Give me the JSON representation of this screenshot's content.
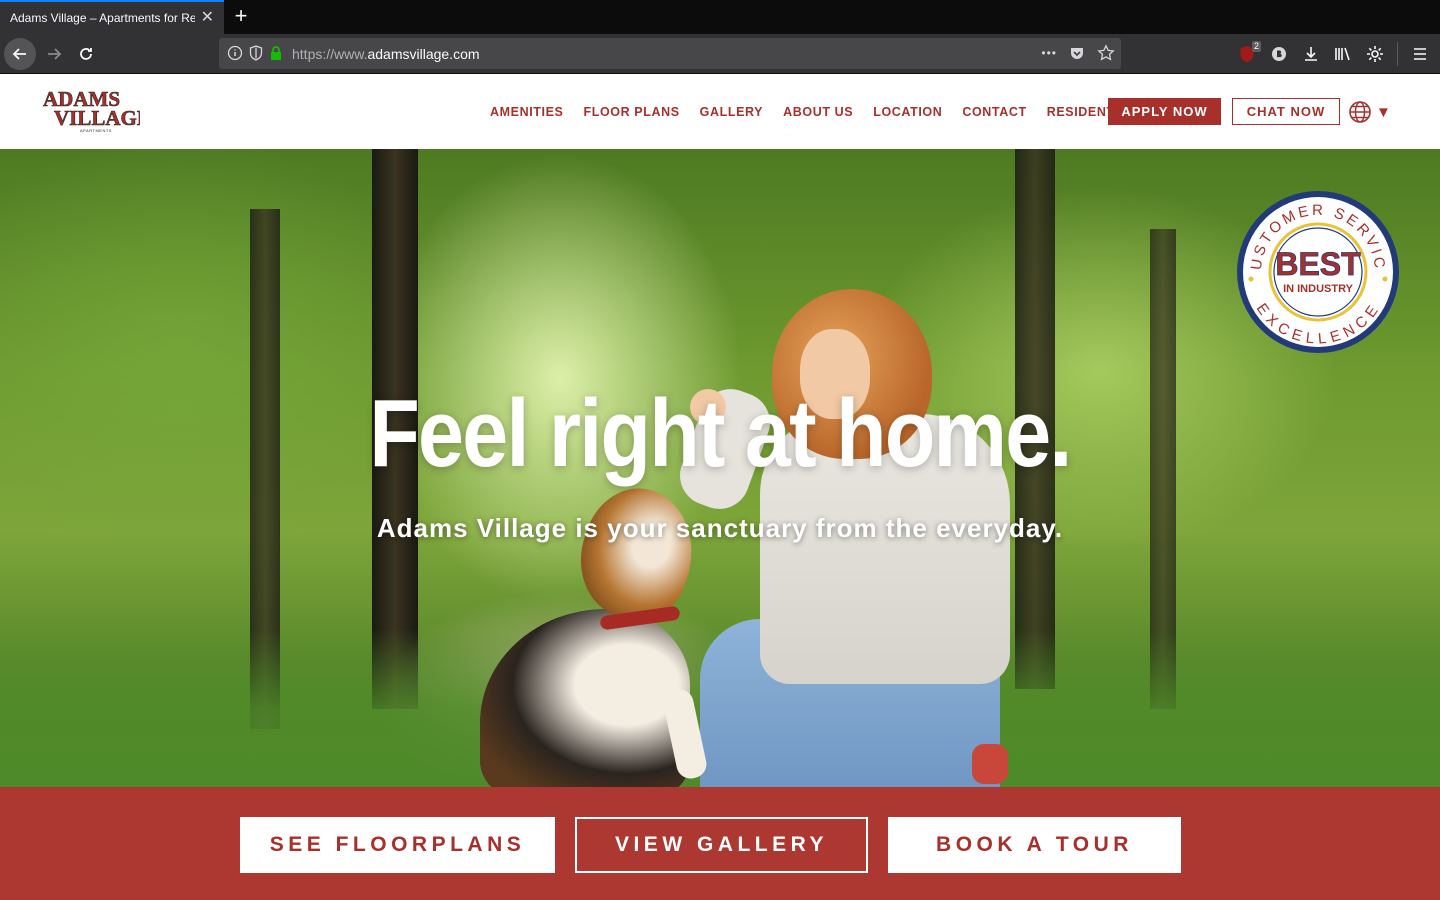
{
  "browser": {
    "tab_title": "Adams Village – Apartments for Ren",
    "tab_close": "✕",
    "new_tab": "+",
    "url_prefix": "https://www.",
    "url_host": "adamsvillage.com",
    "url_more": "•••",
    "extension_badge": "2"
  },
  "header": {
    "logo_text": "Adams Village Apartments",
    "logo_line1": "ADAMS",
    "logo_line2": "VILLAGE",
    "logo_line3": "APARTMENTS",
    "nav": {
      "amenities": "AMENITIES",
      "floor_plans": "FLOOR PLANS",
      "gallery": "GALLERY",
      "about": "ABOUT US",
      "location": "LOCATION",
      "contact": "CONTACT",
      "resident_portal": "RESIDENT PORTAL"
    },
    "apply": "APPLY NOW",
    "chat": "CHAT NOW",
    "lang_arrow": "▼"
  },
  "hero": {
    "title": "Feel right at home.",
    "subtitle": "Adams Village is your sanctuary from the everyday.",
    "seal": {
      "top": "CUSTOMER SERVICE",
      "bottom": "EXCELLENCE",
      "best": "BEST",
      "industry": "IN INDUSTRY"
    }
  },
  "cta": {
    "floorplans": "SEE FLOORPLANS",
    "gallery": "VIEW GALLERY",
    "tour": "BOOK A TOUR"
  },
  "colors": {
    "brand_red": "#a8302b",
    "band_red": "#ad3731",
    "seal_blue": "#233a7a"
  }
}
